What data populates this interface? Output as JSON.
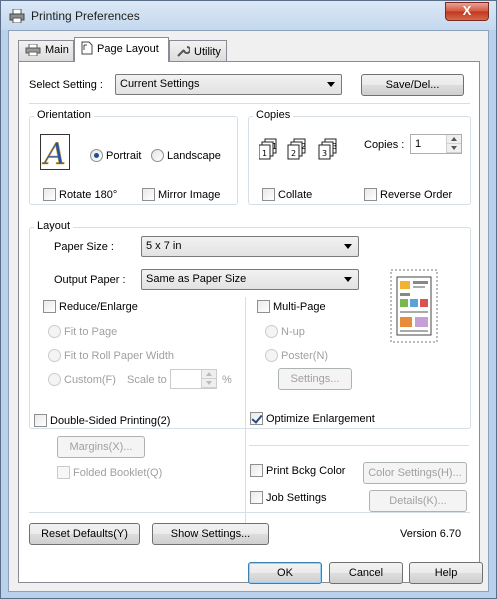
{
  "window": {
    "title": "Printing Preferences",
    "close_label": "X"
  },
  "tabs": [
    {
      "label": "Main"
    },
    {
      "label": "Page Layout"
    },
    {
      "label": "Utility"
    }
  ],
  "select_setting": {
    "label": "Select Setting :",
    "value": "Current Settings",
    "save_label": "Save/Del..."
  },
  "orientation": {
    "title": "Orientation",
    "portrait": "Portrait",
    "landscape": "Landscape",
    "selected": "Portrait",
    "rotate": "Rotate 180°",
    "mirror": "Mirror Image"
  },
  "copies": {
    "title": "Copies",
    "label": "Copies :",
    "value": "1",
    "collate": "Collate",
    "reverse": "Reverse Order"
  },
  "layout": {
    "title": "Layout",
    "paper_size_label": "Paper Size :",
    "paper_size_value": "5 x 7 in",
    "output_paper_label": "Output Paper :",
    "output_paper_value": "Same as Paper Size",
    "reduce_enlarge": "Reduce/Enlarge",
    "fit_to_page": "Fit to Page",
    "fit_to_roll": "Fit to Roll Paper Width",
    "custom": "Custom(F)",
    "scale_to": "Scale to",
    "percent": "%",
    "multi_page": "Multi-Page",
    "nup": "N-up",
    "poster": "Poster(N)",
    "settings_btn": "Settings..."
  },
  "double_sided": {
    "label": "Double-Sided Printing(2)",
    "margins_btn": "Margins(X)...",
    "folded": "Folded Booklet(Q)"
  },
  "optimize": {
    "label": "Optimize Enlargement",
    "checked": true
  },
  "print_bckg": {
    "label": "Print Bckg Color",
    "btn": "Color Settings(H)..."
  },
  "job_settings": {
    "label": "Job Settings",
    "btn": "Details(K)..."
  },
  "footer": {
    "reset": "Reset Defaults(Y)",
    "show": "Show Settings...",
    "version": "Version 6.70"
  },
  "dialog_buttons": {
    "ok": "OK",
    "cancel": "Cancel",
    "help": "Help"
  }
}
